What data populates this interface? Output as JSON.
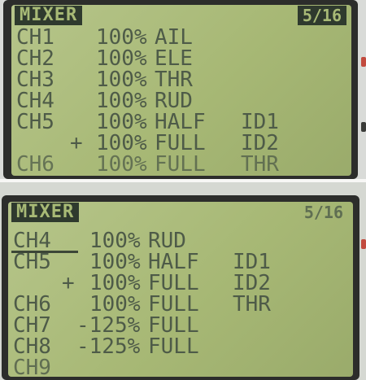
{
  "screens": [
    {
      "title": "MIXER",
      "page": "5/16",
      "rows": [
        {
          "ch": "CH1",
          "rate": "100%",
          "mode": "AIL",
          "switch": ""
        },
        {
          "ch": "CH2",
          "rate": "100%",
          "mode": "ELE",
          "switch": ""
        },
        {
          "ch": "CH3",
          "rate": "100%",
          "mode": "THR",
          "switch": ""
        },
        {
          "ch": "CH4",
          "rate": "100%",
          "mode": "RUD",
          "switch": ""
        },
        {
          "ch": "CH5",
          "rate": "100%",
          "mode": "HALF",
          "switch": "ID1"
        },
        {
          "ch": "+",
          "rate": "100%",
          "mode": "FULL",
          "switch": "ID2"
        },
        {
          "ch": "CH6",
          "rate": "100%",
          "mode": "FULL",
          "switch": "THR"
        }
      ]
    },
    {
      "title": "MIXER",
      "page": "5/16",
      "rows": [
        {
          "ch": "CH4",
          "rate": "100%",
          "mode": "RUD",
          "switch": ""
        },
        {
          "ch": "CH5",
          "rate": "100%",
          "mode": "HALF",
          "switch": "ID1"
        },
        {
          "ch": "+",
          "rate": "100%",
          "mode": "FULL",
          "switch": "ID2"
        },
        {
          "ch": "CH6",
          "rate": "100%",
          "mode": "FULL",
          "switch": "THR"
        },
        {
          "ch": "CH7",
          "rate": "-125%",
          "mode": "FULL",
          "switch": ""
        },
        {
          "ch": "CH8",
          "rate": "-125%",
          "mode": "FULL",
          "switch": ""
        },
        {
          "ch": "CH9",
          "rate": "",
          "mode": "",
          "switch": ""
        }
      ]
    }
  ],
  "colors": {
    "lcd": "#a7b875",
    "text": "#4e5b48",
    "bezel": "#2c2d2b"
  }
}
